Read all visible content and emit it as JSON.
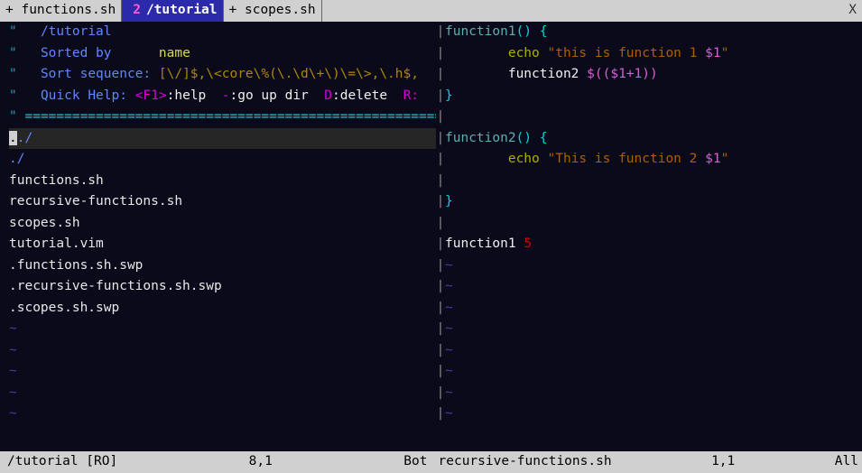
{
  "tabs": {
    "t1": "+ functions.sh",
    "active_num": "2",
    "active_path": "/tutorial",
    "t3": "+ scopes.sh",
    "close": "X"
  },
  "netrw": {
    "title": "/tutorial",
    "sorted_by_label": "Sorted by",
    "sorted_by_value": "name",
    "sort_seq_label": "Sort sequence:",
    "sort_seq_value": "[\\/]$,\\<core\\%(\\.\\d\\+\\)\\=\\>,\\.h$,",
    "help_label": "Quick Help:",
    "help_f1": "<F1>",
    "help_f1_txt": ":help",
    "help_dash": "-",
    "help_dash_txt": ":go up dir",
    "help_d": "D",
    "help_d_txt": ":delete",
    "help_r": "R:",
    "files": [
      "../",
      "./",
      "functions.sh",
      "recursive-functions.sh",
      "scopes.sh",
      "tutorial.vim",
      ".functions.sh.swp",
      ".recursive-functions.sh.swp",
      ".scopes.sh.swp"
    ]
  },
  "code": {
    "l1_fn": "function1",
    "l1_rest": "() {",
    "l2_echo": "echo",
    "l2_str": "\"this is function 1 ",
    "l2_var": "$1",
    "l2_strend": "\"",
    "l3_fn": "function2",
    "l3_expr": "$(($1+1))",
    "l4": "}",
    "l6_fn": "function2",
    "l6_rest": "() {",
    "l7_echo": "echo",
    "l7_str": "\"This is function 2 ",
    "l7_var": "$1",
    "l7_strend": "\"",
    "l9": "}",
    "l11_fn": "function1",
    "l11_arg": "5"
  },
  "status": {
    "left_name": "/tutorial [RO]",
    "left_pos": "8,1",
    "left_pct": "Bot",
    "right_name": "recursive-functions.sh",
    "right_pos": "1,1",
    "right_pct": "All"
  },
  "glyph": {
    "tilde": "~",
    "quote": "\"",
    "bar": "|"
  }
}
